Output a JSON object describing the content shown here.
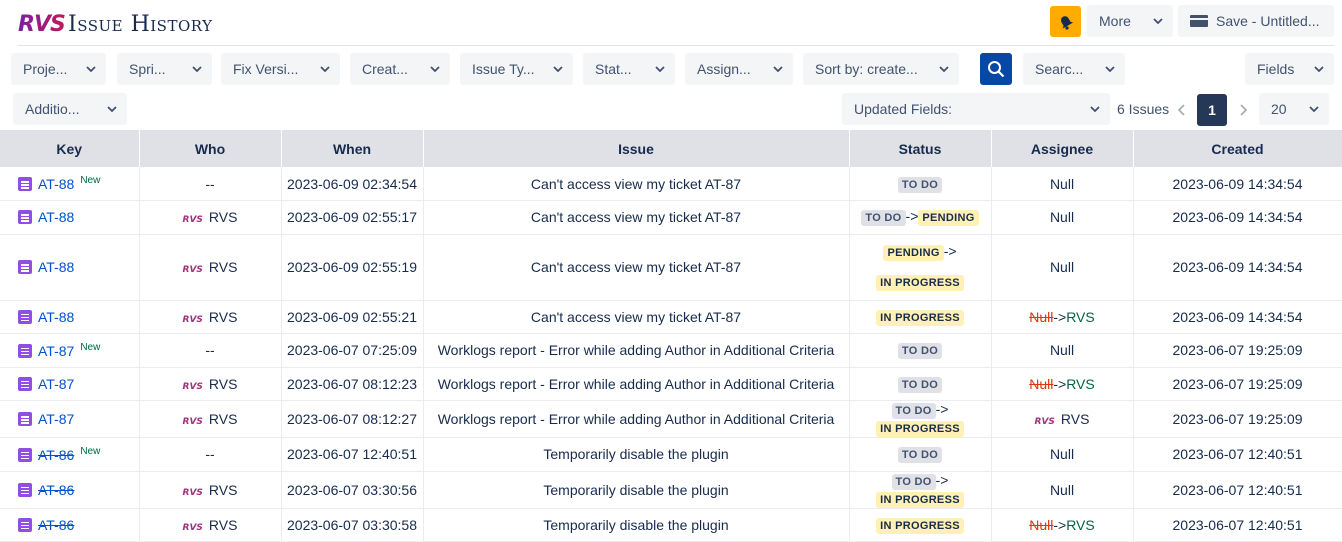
{
  "header": {
    "logo": "RVS",
    "title": "Issue History",
    "more_label": "More",
    "save_label": "Save - Untitled..."
  },
  "filters": {
    "project": "Proje...",
    "sprint": "Spri...",
    "fix_version": "Fix Versi...",
    "created": "Creat...",
    "issue_type": "Issue Ty...",
    "status": "Stat...",
    "assignee": "Assign...",
    "sort": "Sort by: create...",
    "search": "Searc...",
    "fields": "Fields",
    "additional": "Additio...",
    "updated_fields": "Updated Fields:"
  },
  "pagination": {
    "issues_count": "6 Issues",
    "current_page": "1",
    "page_size": "20"
  },
  "columns": [
    "Key",
    "Who",
    "When",
    "Issue",
    "Status",
    "Assignee",
    "Created"
  ],
  "rows": [
    {
      "key": "AT-88",
      "new": "New",
      "who": "--",
      "when": "2023-06-09 02:34:54",
      "issue": "Can't access view my ticket AT-87",
      "status_to": "TO DO",
      "assignee": "Null",
      "created": "2023-06-09 14:34:54"
    },
    {
      "key": "AT-88",
      "who": "RVS",
      "when": "2023-06-09 02:55:17",
      "issue": "Can't access view my ticket AT-87",
      "status_from": "TO DO",
      "status_to": "PENDING",
      "assignee": "Null",
      "created": "2023-06-09 14:34:54"
    },
    {
      "key": "AT-88",
      "who": "RVS",
      "when": "2023-06-09 02:55:19",
      "issue": "Can't access view my ticket AT-87",
      "status_from": "PENDING",
      "status_to": "IN PROGRESS",
      "assignee": "Null",
      "created": "2023-06-09 14:34:54"
    },
    {
      "key": "AT-88",
      "who": "RVS",
      "when": "2023-06-09 02:55:21",
      "issue": "Can't access view my ticket AT-87",
      "status_to": "IN PROGRESS",
      "assignee_from": "Null",
      "assignee_to": "RVS",
      "created": "2023-06-09 14:34:54"
    },
    {
      "key": "AT-87",
      "new": "New",
      "who": "--",
      "when": "2023-06-07 07:25:09",
      "issue": "Worklogs report - Error while adding Author in Additional Criteria",
      "status_to": "TO DO",
      "assignee": "Null",
      "created": "2023-06-07 19:25:09"
    },
    {
      "key": "AT-87",
      "who": "RVS",
      "when": "2023-06-07 08:12:23",
      "issue": "Worklogs report - Error while adding Author in Additional Criteria",
      "status_to": "TO DO",
      "assignee_from": "Null",
      "assignee_to": "RVS",
      "created": "2023-06-07 19:25:09"
    },
    {
      "key": "AT-87",
      "who": "RVS",
      "when": "2023-06-07 08:12:27",
      "issue": "Worklogs report - Error while adding Author in Additional Criteria",
      "status_from": "TO DO",
      "status_to": "IN PROGRESS",
      "assignee": "RVS",
      "created": "2023-06-07 19:25:09"
    },
    {
      "key": "AT-86",
      "new": "New",
      "who": "--",
      "when": "2023-06-07 12:40:51",
      "issue": "Temporarily disable the plugin",
      "status_to": "TO DO",
      "assignee": "Null",
      "created": "2023-06-07 12:40:51"
    },
    {
      "key": "AT-86",
      "who": "RVS",
      "when": "2023-06-07 03:30:56",
      "issue": "Temporarily disable the plugin",
      "status_from": "TO DO",
      "status_to": "IN PROGRESS",
      "assignee": "Null",
      "created": "2023-06-07 12:40:51"
    },
    {
      "key": "AT-86",
      "who": "RVS",
      "when": "2023-06-07 03:30:58",
      "issue": "Temporarily disable the plugin",
      "status_to": "IN PROGRESS",
      "assignee_from": "Null",
      "assignee_to": "RVS",
      "created": "2023-06-07 12:40:51"
    }
  ]
}
